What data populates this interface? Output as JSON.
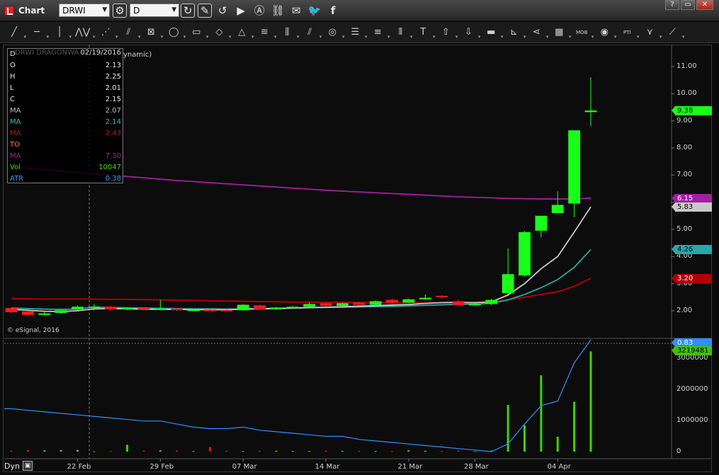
{
  "window": {
    "title": "Chart",
    "symbol": "DRWI",
    "interval": "D",
    "controls": [
      "?",
      "▭",
      "✕"
    ]
  },
  "toolbar_icons": [
    "cycle-icon",
    "refresh-icon",
    "pencil-icon",
    "back-icon",
    "play-icon",
    "alert-icon",
    "link-icon",
    "chat-icon",
    "twitter-icon",
    "facebook-icon"
  ],
  "draw_tools": [
    "╱",
    "─",
    "│",
    "⋀⋁",
    "⋰",
    "⫽",
    "⊠",
    "◯",
    "▭",
    "◇",
    "△",
    "≋",
    "⫼",
    "⫽",
    "◎",
    "☰",
    "≡",
    "⦀",
    "T",
    "⇧",
    "⇩",
    "▬",
    "⊾",
    "⋖",
    "▦",
    "MOB",
    "◉",
    "PTI",
    "⋎",
    "⟋"
  ],
  "databox": {
    "symbol_line": "DRWI DRAGONWA",
    "date": "02/19/2016",
    "dynamic_tail": "ynamic)",
    "rows": [
      {
        "k": "D",
        "v": "",
        "color": "#e6e6e6"
      },
      {
        "k": "O",
        "v": "2.13",
        "color": "#e6e6e6"
      },
      {
        "k": "H",
        "v": "2.25",
        "color": "#e6e6e6"
      },
      {
        "k": "L",
        "v": "2.01",
        "color": "#e6e6e6"
      },
      {
        "k": "C",
        "v": "2.15",
        "color": "#e6e6e6"
      },
      {
        "k": "MA",
        "v": "2.07",
        "color": "#bdbdbd"
      },
      {
        "k": "MA",
        "v": "2.14",
        "color": "#3fb8b8"
      },
      {
        "k": "MA",
        "v": "2.43",
        "color": "#c01818"
      },
      {
        "k": "TO",
        "v": "",
        "color": "#ff7a3a"
      },
      {
        "k": "MA",
        "v": "7.30",
        "color": "#a020a0"
      },
      {
        "k": "Vol",
        "v": "10047",
        "color": "#4dd400"
      },
      {
        "k": "ATR",
        "v": "0.38",
        "color": "#3b9cff"
      }
    ]
  },
  "copyright": "© eSignal, 2016",
  "price_axis": [
    "11.00",
    "10.00",
    "9.00",
    "8.00",
    "7.00",
    "6.00",
    "5.00",
    "4.00",
    "3.00",
    "2.00"
  ],
  "volume_axis": [
    "3000000",
    "2000000",
    "1000000",
    "0"
  ],
  "date_axis": [
    {
      "label": "22 Feb",
      "day": 4
    },
    {
      "label": "29 Feb",
      "day": 9
    },
    {
      "label": "07 Mar",
      "day": 14
    },
    {
      "label": "14 Mar",
      "day": 19
    },
    {
      "label": "21 Mar",
      "day": 24
    },
    {
      "label": "28 Mar",
      "day": 28
    },
    {
      "label": "04 Apr",
      "day": 33
    }
  ],
  "price_tags": [
    {
      "text": "9.38",
      "price": 9.38,
      "bg": "#19ff19",
      "fg": "#000"
    },
    {
      "text": "6.15",
      "price": 6.15,
      "bg": "#a020a0",
      "fg": "#fff"
    },
    {
      "text": "5.83",
      "price": 5.83,
      "bg": "#c8c8c8",
      "fg": "#000"
    },
    {
      "text": "4.26",
      "price": 4.26,
      "bg": "#2aa6a6",
      "fg": "#000"
    },
    {
      "text": "3.20",
      "price": 3.2,
      "bg": "#b00000",
      "fg": "#fff"
    }
  ],
  "lower_tags": [
    {
      "text": "0.83",
      "bg": "#2f8fff",
      "fg": "#fff"
    },
    {
      "text": "3219481",
      "bg": "#3fc200",
      "fg": "#000"
    }
  ],
  "dyn_label": "Dyn",
  "chart_data": {
    "type": "candlestick",
    "symbol": "DRWI",
    "candles": [
      [
        2.1,
        2.12,
        1.9,
        1.95
      ],
      [
        1.98,
        2.0,
        1.8,
        1.85
      ],
      [
        1.85,
        1.95,
        1.82,
        1.9
      ],
      [
        1.92,
        2.05,
        1.9,
        2.02
      ],
      [
        2.05,
        2.2,
        2.03,
        2.15
      ],
      [
        2.13,
        2.25,
        2.01,
        2.15
      ],
      [
        2.15,
        2.18,
        2.0,
        2.05
      ],
      [
        2.05,
        2.12,
        2.02,
        2.1
      ],
      [
        2.1,
        2.12,
        2.02,
        2.05
      ],
      [
        2.05,
        2.4,
        2.02,
        2.08
      ],
      [
        2.08,
        2.1,
        2.0,
        2.02
      ],
      [
        2.02,
        2.06,
        2.0,
        2.04
      ],
      [
        2.04,
        2.08,
        2.0,
        2.02
      ],
      [
        2.03,
        2.05,
        2.0,
        2.02
      ],
      [
        2.02,
        2.25,
        2.0,
        2.22
      ],
      [
        2.2,
        2.22,
        2.05,
        2.05
      ],
      [
        2.05,
        2.15,
        2.03,
        2.12
      ],
      [
        2.12,
        2.18,
        2.08,
        2.15
      ],
      [
        2.15,
        2.32,
        2.12,
        2.25
      ],
      [
        2.28,
        2.3,
        2.15,
        2.18
      ],
      [
        2.18,
        2.3,
        2.16,
        2.28
      ],
      [
        2.3,
        2.32,
        2.2,
        2.22
      ],
      [
        2.22,
        2.38,
        2.2,
        2.35
      ],
      [
        2.4,
        2.45,
        2.25,
        2.3
      ],
      [
        2.3,
        2.45,
        2.28,
        2.42
      ],
      [
        2.42,
        2.6,
        2.4,
        2.48
      ],
      [
        2.55,
        2.58,
        2.45,
        2.5
      ],
      [
        2.35,
        2.4,
        2.2,
        2.2
      ],
      [
        2.22,
        2.28,
        2.18,
        2.25
      ],
      [
        2.25,
        2.45,
        2.2,
        2.4
      ],
      [
        2.65,
        4.3,
        2.6,
        3.35
      ],
      [
        3.3,
        4.95,
        3.25,
        4.9
      ],
      [
        4.95,
        5.1,
        4.7,
        5.5
      ],
      [
        5.6,
        6.4,
        5.6,
        5.9
      ],
      [
        5.95,
        6.1,
        5.45,
        8.65
      ],
      [
        9.32,
        10.6,
        8.8,
        9.38
      ]
    ],
    "ma_gray": [
      2.05,
      2.02,
      1.98,
      1.97,
      2.0,
      2.07,
      2.08,
      2.07,
      2.06,
      2.05,
      2.05,
      2.04,
      2.04,
      2.04,
      2.06,
      2.07,
      2.08,
      2.1,
      2.12,
      2.13,
      2.15,
      2.17,
      2.19,
      2.21,
      2.23,
      2.27,
      2.3,
      2.31,
      2.3,
      2.33,
      2.58,
      3.0,
      3.55,
      4.0,
      4.9,
      5.83
    ],
    "ma_teal": [
      2.1,
      2.08,
      2.06,
      2.05,
      2.06,
      2.14,
      2.12,
      2.11,
      2.1,
      2.09,
      2.08,
      2.07,
      2.07,
      2.06,
      2.07,
      2.08,
      2.09,
      2.1,
      2.11,
      2.12,
      2.13,
      2.14,
      2.15,
      2.16,
      2.18,
      2.2,
      2.22,
      2.24,
      2.25,
      2.27,
      2.4,
      2.6,
      2.85,
      3.15,
      3.6,
      4.26
    ],
    "ma_red": [
      2.45,
      2.44,
      2.43,
      2.43,
      2.43,
      2.43,
      2.42,
      2.42,
      2.41,
      2.4,
      2.39,
      2.38,
      2.37,
      2.36,
      2.35,
      2.34,
      2.33,
      2.32,
      2.32,
      2.31,
      2.31,
      2.31,
      2.3,
      2.3,
      2.3,
      2.3,
      2.3,
      2.31,
      2.3,
      2.32,
      2.4,
      2.5,
      2.6,
      2.7,
      2.9,
      3.2
    ],
    "ma_purple": [
      7.3,
      7.25,
      7.2,
      7.15,
      7.1,
      7.05,
      7.0,
      6.95,
      6.9,
      6.85,
      6.8,
      6.76,
      6.72,
      6.68,
      6.64,
      6.6,
      6.56,
      6.52,
      6.48,
      6.44,
      6.41,
      6.38,
      6.35,
      6.32,
      6.29,
      6.26,
      6.23,
      6.2,
      6.18,
      6.16,
      6.14,
      6.13,
      6.12,
      6.12,
      6.12,
      6.15
    ],
    "volume": [
      30000,
      45000,
      40000,
      50000,
      60000,
      10047,
      20000,
      220000,
      30000,
      40000,
      35000,
      20000,
      150000,
      25000,
      20000,
      25000,
      30000,
      25000,
      20000,
      30000,
      25000,
      20000,
      20000,
      15000,
      40000,
      30000,
      20000,
      30000,
      15000,
      35000,
      1500000,
      850000,
      2450000,
      480000,
      1600000,
      3219481
    ],
    "atr": [
      0.38,
      0.37,
      0.36,
      0.35,
      0.34,
      0.33,
      0.32,
      0.31,
      0.3,
      0.3,
      0.28,
      0.26,
      0.25,
      0.25,
      0.26,
      0.24,
      0.23,
      0.22,
      0.21,
      0.2,
      0.2,
      0.18,
      0.17,
      0.16,
      0.15,
      0.14,
      0.13,
      0.12,
      0.11,
      0.1,
      0.15,
      0.28,
      0.4,
      0.43,
      0.68,
      0.83
    ],
    "ylim": [
      1.5,
      11.5
    ],
    "vol_ylim": [
      0,
      3300000
    ]
  }
}
